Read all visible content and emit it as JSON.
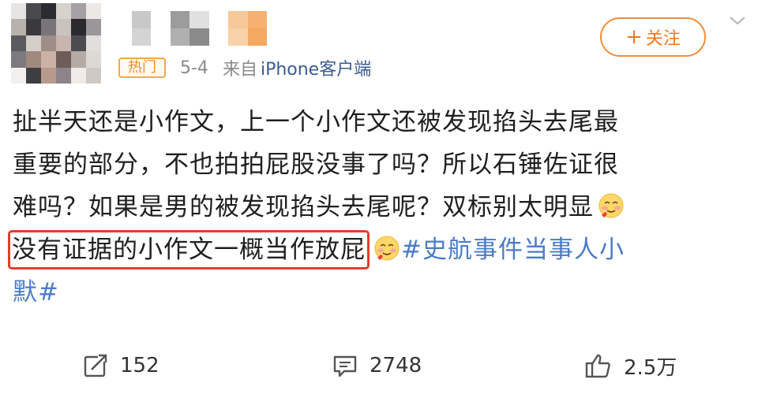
{
  "post": {
    "hot_badge": "热门",
    "date": "5-4",
    "source_prefix": "来自",
    "source": "iPhone客户端",
    "follow_label": "关注",
    "lines": [
      "扯半天还是小作文，上一个小作文还被发现掐头去尾最",
      "重要的部分，不也拍拍屁股没事了吗？所以石锤佐证很",
      "难吗？如果是男的被发现掐头去尾呢？双标别太明显"
    ],
    "highlight_text": "没有证据的小作文一概当作放屁",
    "hashtag_line1": "#史航事件当事人小",
    "hashtag_line2": "默#",
    "emoji_name": "smiling-face-with-hearts-emoji"
  },
  "actions": {
    "repost_count": "152",
    "comment_count": "2748",
    "like_count": "2.5万"
  },
  "colors": {
    "follow_orange": "#f07820",
    "highlight_red": "#e53c2e",
    "link_blue": "#4a7cc7",
    "meta_gray": "#8a8a8a",
    "hot_badge_orange": "#e8901a"
  }
}
